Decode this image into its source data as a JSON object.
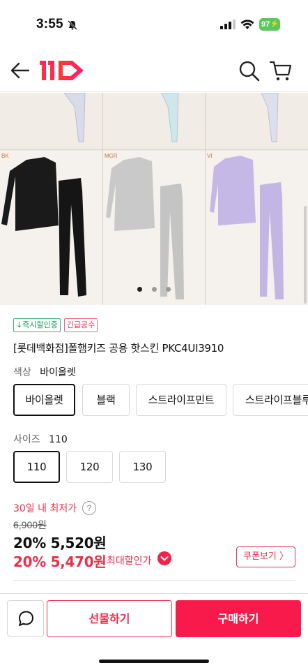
{
  "status_bar": {
    "time": "3:55",
    "battery": "97"
  },
  "header": {
    "logo_text": "11",
    "brand_color": "#f43142"
  },
  "gallery": {
    "panel_labels": [
      "BK",
      "MGR",
      "VI"
    ],
    "dots_total": 3,
    "active_dot": 0
  },
  "badges": [
    {
      "label": "↓즉시할인중",
      "color": "#1b9a5b"
    },
    {
      "label": "긴급공수",
      "color": "#e8304a"
    }
  ],
  "product": {
    "title": "[롯데백화점]폴햄키즈 공용 핫스킨 PKC4UI3910"
  },
  "color_option": {
    "label": "색상",
    "selected": "바이올렛",
    "choices": [
      "바이올렛",
      "블랙",
      "스트라이프민트",
      "스트라이프블루"
    ]
  },
  "size_option": {
    "label": "사이즈",
    "selected": "110",
    "choices": [
      "110",
      "120",
      "130"
    ]
  },
  "pricing": {
    "lowest_label": "30일 내 최저가",
    "help_symbol": "?",
    "original_price": "6,900원",
    "price_line1": "20% 5,520원",
    "price_line2": "20% 5,470원",
    "max_discount_label": "최대할인가",
    "coupon_button": "쿠폰보기 〉"
  },
  "bottom_bar": {
    "gift_label": "선물하기",
    "buy_label": "구매하기"
  },
  "colors": {
    "accent": "#e8304a",
    "buy_button": "#f71a4a",
    "green": "#1b9a5b"
  }
}
